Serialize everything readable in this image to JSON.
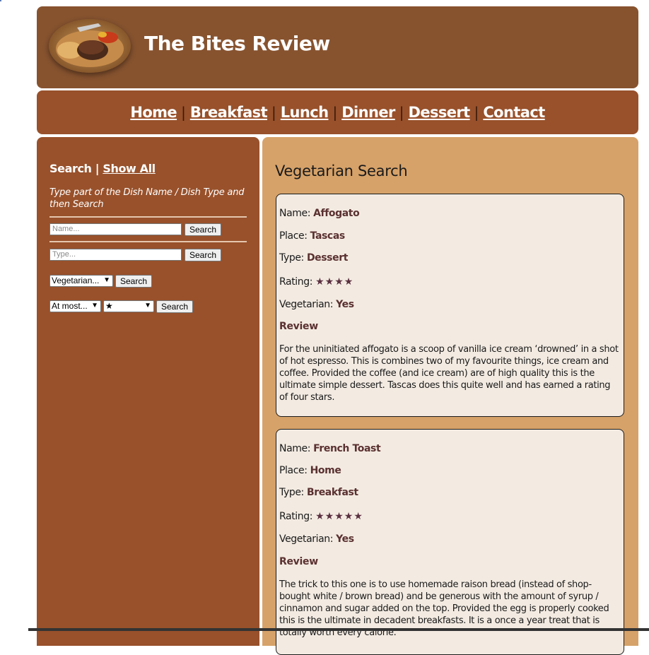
{
  "site": {
    "title": "The Bites Review"
  },
  "nav": {
    "home": "Home",
    "breakfast": "Breakfast",
    "lunch": "Lunch",
    "dinner": "Dinner",
    "dessert": "Dessert",
    "contact": "Contact",
    "separator": "|"
  },
  "sidebar": {
    "search_label": "Search",
    "separator": "|",
    "show_all": "Show All",
    "hint": "Type part of the Dish Name / Dish Type and then Search",
    "name_placeholder": "Name...",
    "type_placeholder": "Type...",
    "search_button": "Search",
    "veg_select": "Vegetarian...",
    "compare_select": "At most...",
    "stars_select": "★"
  },
  "main": {
    "heading": "Vegetarian Search",
    "labels": {
      "name": "Name:",
      "place": "Place:",
      "type": "Type:",
      "rating": "Rating:",
      "vegetarian": "Vegetarian:",
      "review": "Review"
    },
    "items": [
      {
        "name": "Affogato",
        "place": "Tascas",
        "type": "Dessert",
        "rating": "★★★★",
        "vegetarian": "Yes",
        "review": "For the uninitiated affogato is a scoop of vanilla ice cream ‘drowned’ in a shot of hot espresso. This is combines two of my favourite things, ice cream and coffee. Provided the coffee (and ice cream) are of high quality this is the ultimate simple dessert. Tascas does this quite well and has earned a rating of four stars."
      },
      {
        "name": "French Toast",
        "place": "Home",
        "type": "Breakfast",
        "rating": "★★★★★",
        "vegetarian": "Yes",
        "review": "The trick to this one is to use homemade raison bread (instead of shop-bought white / brown bread) and be generous with the amount of syrup / cinnamon and sugar added on the top. Provided the egg is properly cooked this is the ultimate in decadent breakfasts. It is a once a year treat that is totally worth every calorie."
      }
    ]
  },
  "colors": {
    "header": "#87532f",
    "nav": "#98512b",
    "sidebar": "#98512b",
    "main": "#d6a269",
    "card": "#f3ebe2"
  },
  "icons": {
    "logo": "steak-plate-image"
  }
}
